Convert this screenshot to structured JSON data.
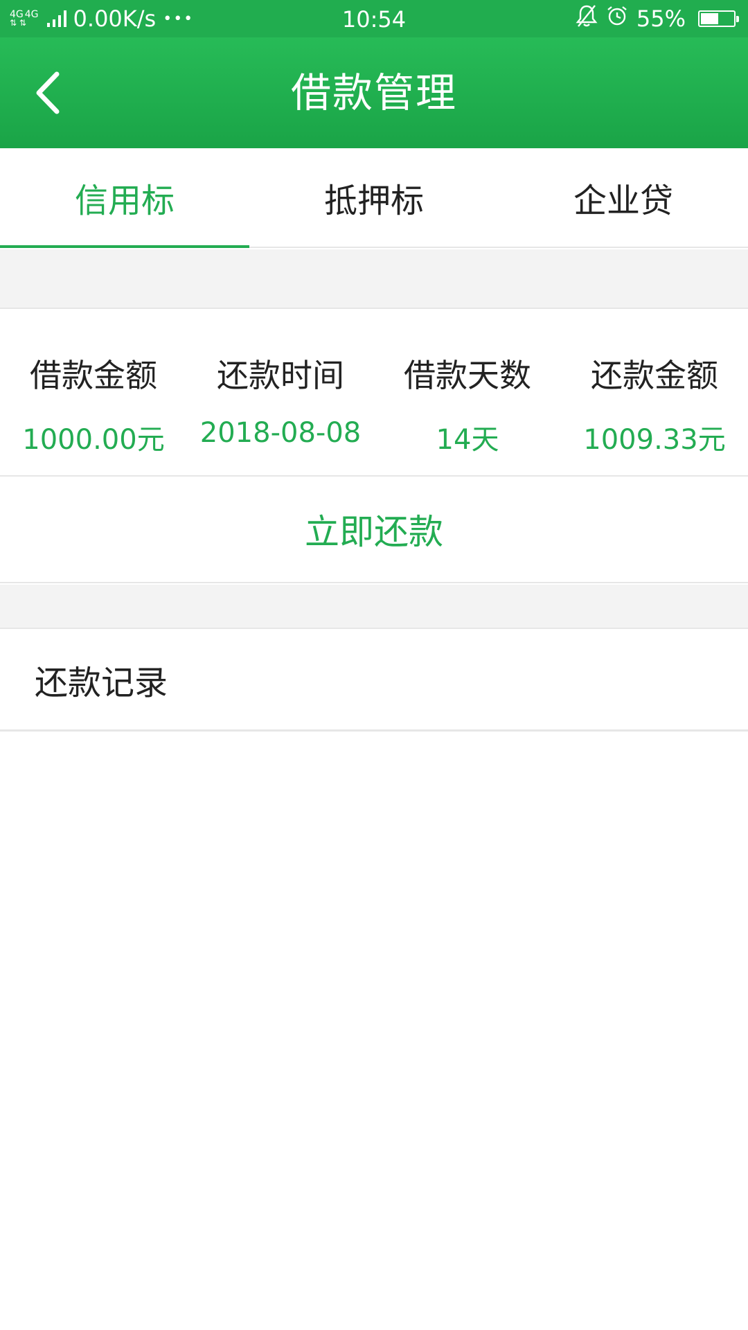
{
  "status_bar": {
    "network_1": "4G",
    "network_2": "4G",
    "speed": "0.00K/s",
    "more": "•••",
    "time": "10:54",
    "battery_percent": "55%",
    "battery_level": 0.55
  },
  "header": {
    "title": "借款管理"
  },
  "tabs": [
    {
      "label": "信用标",
      "active": true
    },
    {
      "label": "抵押标",
      "active": false
    },
    {
      "label": "企业贷",
      "active": false
    }
  ],
  "summary": {
    "items": [
      {
        "label": "借款金额",
        "value": "1000.00元"
      },
      {
        "label": "还款时间",
        "value": "2018-08-08"
      },
      {
        "label": "借款天数",
        "value": "14天"
      },
      {
        "label": "还款金额",
        "value": "1009.33元"
      }
    ]
  },
  "actions": {
    "repay_label": "立即还款"
  },
  "records": {
    "label": "还款记录"
  },
  "colors": {
    "brand_green": "#23ac52",
    "header_green": "#21ad4f"
  }
}
